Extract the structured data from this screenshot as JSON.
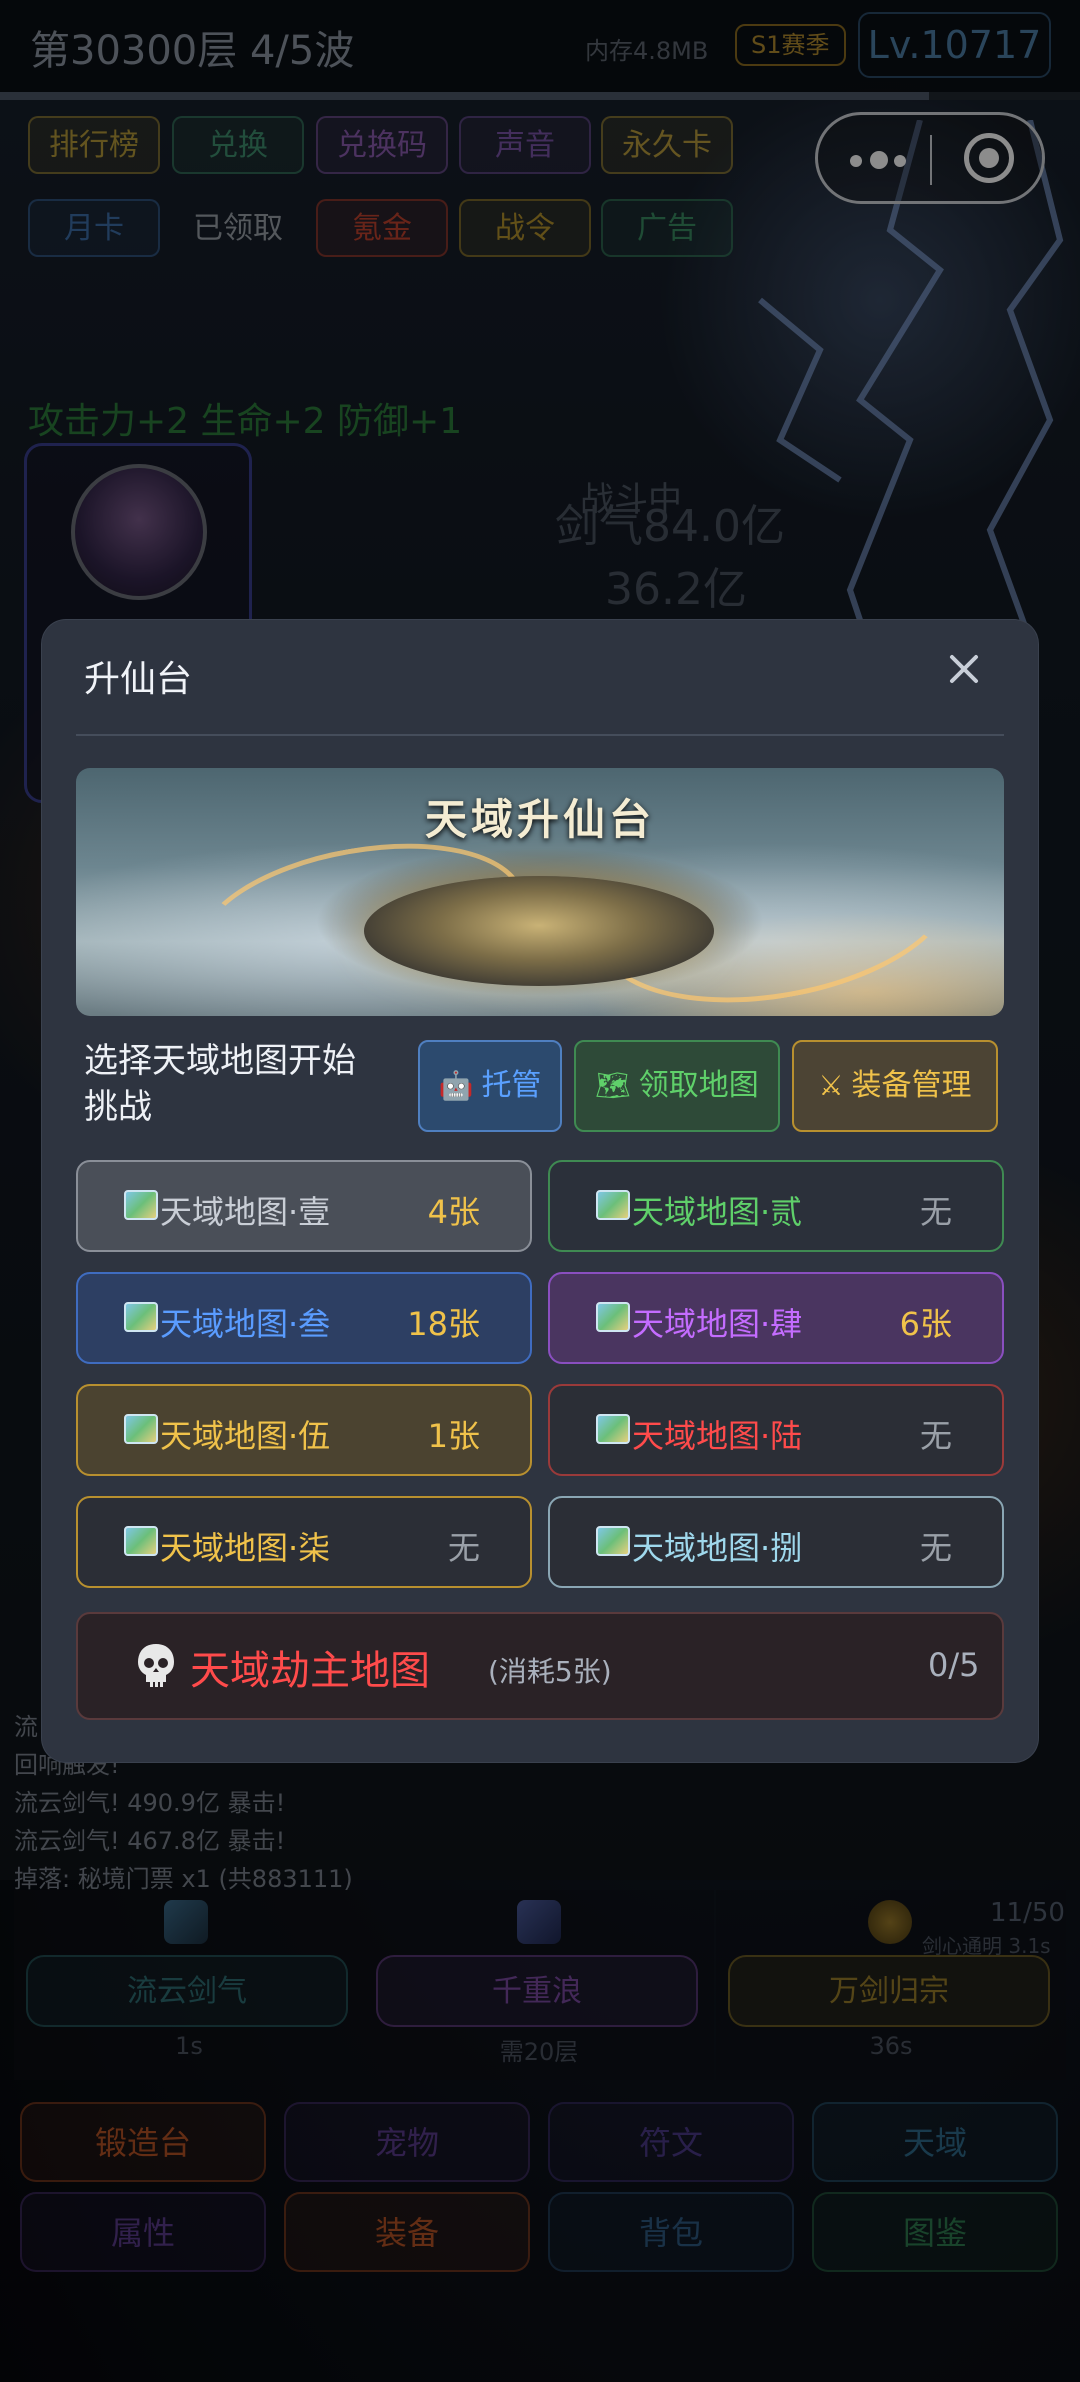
{
  "header": {
    "floor_title": "第30300层 4/5波",
    "memory": "内存4.8MB",
    "season": "S1赛季",
    "level": "Lv.10717",
    "progress": 0.86
  },
  "quick_buttons": [
    {
      "label": "排行榜",
      "color": "#b59a3a"
    },
    {
      "label": "兑换",
      "color": "#3f8f6e"
    },
    {
      "label": "兑换码",
      "color": "#8b5bb0"
    },
    {
      "label": "声音",
      "color": "#7a55a8"
    },
    {
      "label": "永久卡",
      "color": "#b89b3c"
    },
    {
      "label": "月卡",
      "color": "#3d6ea8"
    },
    {
      "label": "已领取",
      "color": "#9aa0a8"
    },
    {
      "label": "氪金",
      "color": "#c0432f"
    },
    {
      "label": "战令",
      "color": "#b3922d"
    },
    {
      "label": "广告",
      "color": "#3a8a62"
    }
  ],
  "battle": {
    "stats_line": "攻击力+2 生命+2 防御+1",
    "state": "战斗中",
    "sword_qi": "剑气84.0亿",
    "sword_value": "36.2亿"
  },
  "log": {
    "lines": [
      "流",
      "回响触发!",
      "流云剑气! 490.9亿 暴击!",
      "流云剑气! 467.8亿 暴击!",
      "掉落: 秘境门票 x1 (共883111)"
    ]
  },
  "skills": [
    {
      "label": "流云剑气",
      "sub": "1s",
      "color": "#2f6e73"
    },
    {
      "label": "千重浪",
      "sub": "需20层",
      "color": "#7a4aa0"
    },
    {
      "label": "万剑归宗",
      "sub": "36s",
      "color": "#9a7f2a"
    }
  ],
  "charge": "11/50",
  "sword_heart": "剑心通明 3.1s",
  "nav": [
    {
      "label": "锻造台",
      "color": "#b55226"
    },
    {
      "label": "宠物",
      "color": "#5a3b8a"
    },
    {
      "label": "符文",
      "color": "#4c3a88"
    },
    {
      "label": "天域",
      "color": "#2f6a8a"
    },
    {
      "label": "属性",
      "color": "#5a3b8a"
    },
    {
      "label": "装备",
      "color": "#b55226"
    },
    {
      "label": "背包",
      "color": "#2f5a82"
    },
    {
      "label": "图鉴",
      "color": "#2f7a4f"
    }
  ],
  "modal": {
    "title": "升仙台",
    "banner_title": "天域升仙台",
    "prompt": "选择天域地图开始挑战",
    "actions": [
      {
        "label": "托管",
        "icon": "robot-icon",
        "color": "#5aa0ff",
        "bg": "#2c4a6e",
        "border": "#4f7fc0"
      },
      {
        "label": "领取地图",
        "icon": "map-icon",
        "color": "#5fd06a",
        "bg": "#2e4a38",
        "border": "#3f8a52"
      },
      {
        "label": "装备管理",
        "icon": "crossed-swords-icon",
        "color": "#f0c24a",
        "bg": "#4c4434",
        "border": "#b8902f"
      }
    ],
    "maps": [
      {
        "label": "天域地图·壹",
        "count": "4张",
        "text": "#c9ced6",
        "count_color": "#f0c24a",
        "bg": "#4a4f58",
        "border": "#8a8f98"
      },
      {
        "label": "天域地图·贰",
        "count": "无",
        "text": "#5fd06a",
        "count_color": "#9aa0a8",
        "bg": "#2b303a",
        "border": "#3f8a52"
      },
      {
        "label": "天域地图·叁",
        "count": "18张",
        "text": "#5a9cff",
        "count_color": "#f0c24a",
        "bg": "#2d3f63",
        "border": "#3f6cc0"
      },
      {
        "label": "天域地图·肆",
        "count": "6张",
        "text": "#c46cff",
        "count_color": "#f0c24a",
        "bg": "#4a3560",
        "border": "#8a4fc0"
      },
      {
        "label": "天域地图·伍",
        "count": "1张",
        "text": "#f0c24a",
        "count_color": "#f0c24a",
        "bg": "#4b4330",
        "border": "#b8902f"
      },
      {
        "label": "天域地图·陆",
        "count": "无",
        "text": "#ff4b4b",
        "count_color": "#9aa0a8",
        "bg": "#2b2e36",
        "border": "#9a3a3a"
      },
      {
        "label": "天域地图·柒",
        "count": "无",
        "text": "#f0c24a",
        "count_color": "#9aa0a8",
        "bg": "#2b2e36",
        "border": "#b8902f"
      },
      {
        "label": "天域地图·捌",
        "count": "无",
        "text": "#9fd8ec",
        "count_color": "#9aa0a8",
        "bg": "#2b2e36",
        "border": "#8aa6b4"
      }
    ],
    "boss": {
      "label": "天域劫主地图",
      "cost": "(消耗5张)",
      "count": "0/5"
    }
  }
}
